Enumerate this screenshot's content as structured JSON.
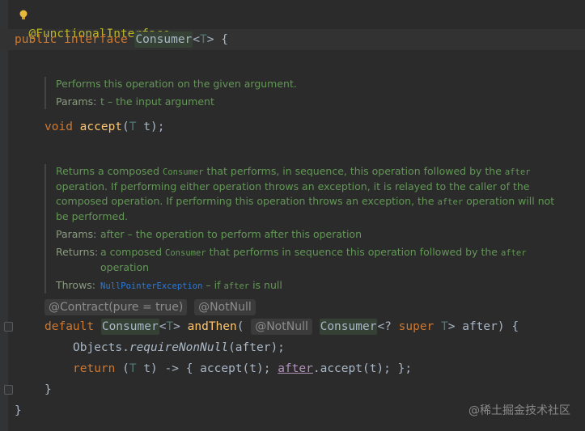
{
  "code": {
    "annotation": "@FunctionalInterface",
    "decl": {
      "public": "public",
      "interface": "interface",
      "name": "Consumer",
      "lt": "<",
      "T": "T",
      "gt": ">",
      "brace": " {"
    },
    "accept_line": {
      "void": "void",
      "name": "accept",
      "open": "(",
      "T": "T",
      "rest": " t);"
    },
    "contract_inlay": "@Contract(pure = true)",
    "notnull_inlay": "@NotNull",
    "andthen": {
      "default": "default",
      "consumer": "Consumer",
      "lt": "<",
      "T": "T",
      "gt": ">",
      "name": "andThen",
      "open": "(",
      "inlay": "@NotNull",
      "param_type": "Consumer",
      "wild": "<? ",
      "super": "super",
      "T2": "T",
      "rest": "> after) {"
    },
    "body1": {
      "obj": "Objects.",
      "method": "requireNonNull",
      "rest": "(after);"
    },
    "body2": {
      "return": "return",
      "open": " (",
      "T": "T",
      "mid": " t) -> { accept(t); ",
      "after": "after",
      "rest": ".accept(t); };"
    },
    "close_inner": "}",
    "close_outer": "}"
  },
  "doc1": {
    "summary": "Performs this operation on the given argument.",
    "params_label": "Params:",
    "params_value": "t – the input argument"
  },
  "doc2": {
    "p1": "Returns a composed ",
    "p1_code": "Consumer",
    "p2": " that performs, in sequence, this operation followed by the ",
    "p2_code": "after",
    "p3": " operation. If performing either operation throws an exception, it is relayed to the caller of the composed operation. If performing this operation throws an exception, the ",
    "p3_code": "after",
    "p4": " operation will not be performed.",
    "params_label": "Params:",
    "params_value": "after – the operation to perform after this operation",
    "returns_label": "Returns:",
    "returns_1": "a composed ",
    "returns_code1": "Consumer",
    "returns_2": " that performs in sequence this operation followed by the ",
    "returns_code2": "after",
    "returns_3": " operation",
    "throws_label": "Throws:",
    "throws_link": "NullPointerException",
    "throws_1": " – if ",
    "throws_code": "after",
    "throws_2": " is null"
  },
  "watermark": "@稀土掘金技术社区",
  "icons": {
    "bulb": "lightbulb-icon",
    "fold": "fold-marker-icon"
  }
}
